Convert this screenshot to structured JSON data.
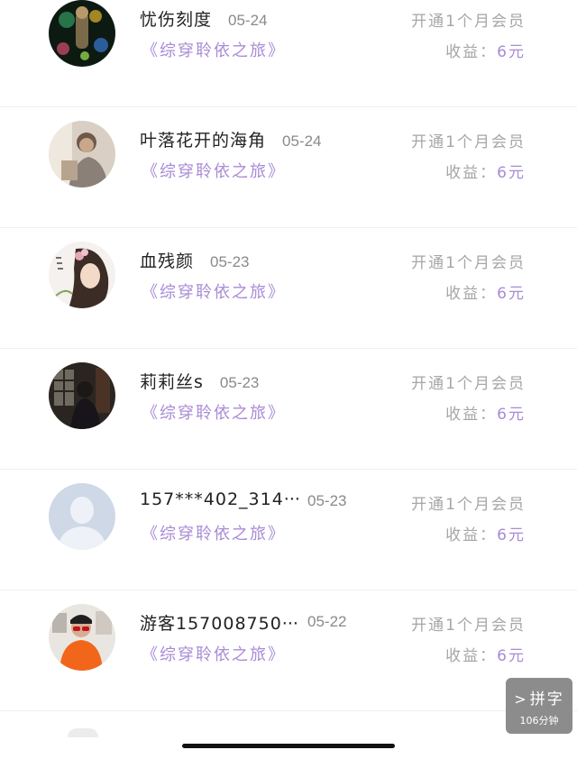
{
  "records": [
    {
      "name": "忧伤刻度",
      "date": "05-24",
      "book": "《综穿聆依之旅》",
      "status": "开通1个月会员",
      "earn_label": "收益：",
      "earn_value": "6元",
      "avatar": "dark-flowers-avatar"
    },
    {
      "name": "叶落花开的海角",
      "date": "05-24",
      "book": "《综穿聆依之旅》",
      "status": "开通1个月会员",
      "earn_label": "收益：",
      "earn_value": "6元",
      "avatar": "sepia-portrait-avatar"
    },
    {
      "name": "血残颜",
      "date": "05-23",
      "book": "《综穿聆依之旅》",
      "status": "开通1个月会员",
      "earn_label": "收益：",
      "earn_value": "6元",
      "avatar": "anime-girl-avatar"
    },
    {
      "name": "莉莉丝s",
      "date": "05-23",
      "book": "《综穿聆依之旅》",
      "status": "开通1个月会员",
      "earn_label": "收益：",
      "earn_value": "6元",
      "avatar": "dark-room-avatar"
    },
    {
      "name": "157***402_314",
      "name_suffix": "···",
      "date": "05-23",
      "book": "《综穿聆依之旅》",
      "status": "开通1个月会员",
      "earn_label": "收益：",
      "earn_value": "6元",
      "avatar": "default-user-avatar"
    },
    {
      "name": "游客157008750",
      "name_suffix": "···",
      "date": "05-22",
      "book": "《综穿聆依之旅》",
      "status": "开通1个月会员",
      "earn_label": "收益：",
      "earn_value": "6元",
      "avatar": "red-shirt-photo-avatar"
    }
  ],
  "float_button": {
    "arrow": ">",
    "label": "拼字",
    "sublabel": "106分钟"
  }
}
